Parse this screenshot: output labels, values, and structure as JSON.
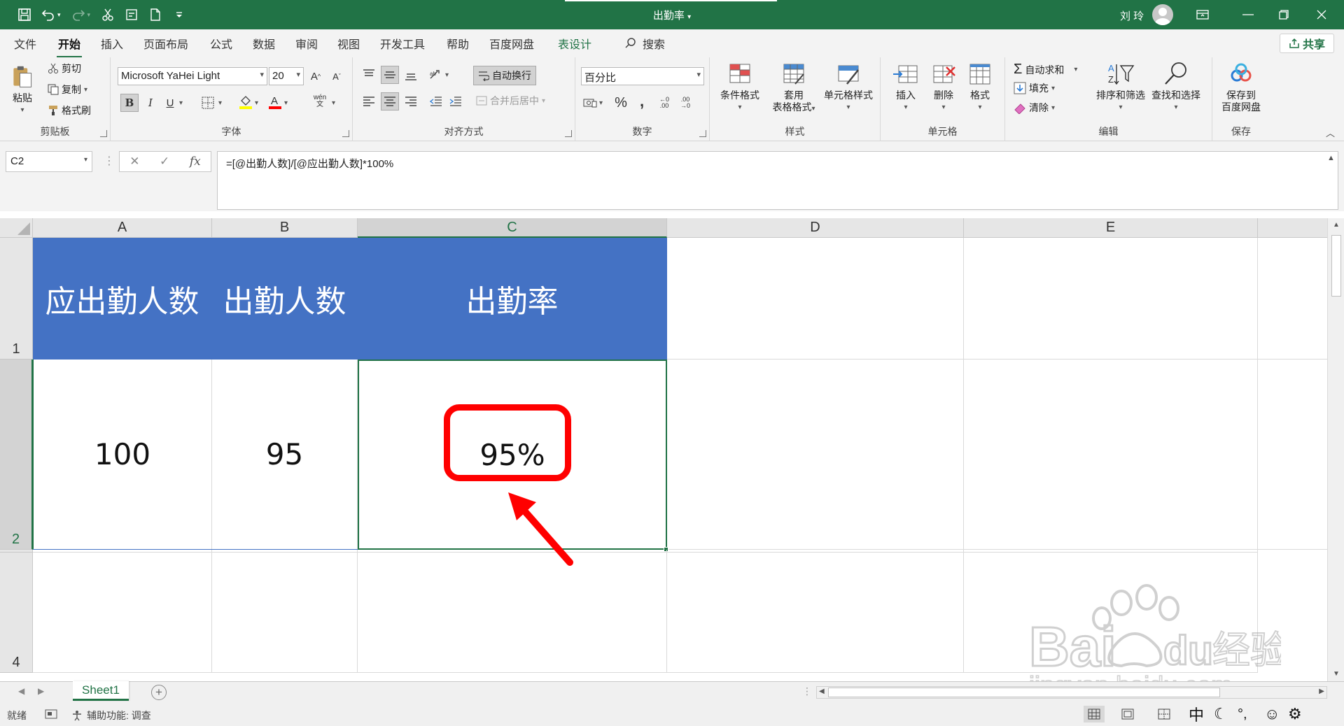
{
  "window": {
    "title": "出勤率",
    "user": "刘 玲"
  },
  "tabs": [
    "文件",
    "开始",
    "插入",
    "页面布局",
    "公式",
    "数据",
    "审阅",
    "视图",
    "开发工具",
    "帮助",
    "百度网盘",
    "表设计"
  ],
  "search_label": "搜索",
  "share_label": "共享",
  "ribbon": {
    "clipboard": {
      "paste": "粘贴",
      "cut": "剪切",
      "copy": "复制",
      "format_painter": "格式刷",
      "label": "剪贴板"
    },
    "font": {
      "name": "Microsoft YaHei Light",
      "size": "20",
      "label": "字体",
      "phonetic": "wén",
      "phonetic_sub": "文"
    },
    "alignment": {
      "wrap": "自动换行",
      "merge": "合并后居中",
      "label": "对齐方式"
    },
    "number": {
      "format": "百分比",
      "label": "数字"
    },
    "styles": {
      "conditional": "条件格式",
      "table_format_1": "套用",
      "table_format_2": "表格格式",
      "cell_styles": "单元格样式",
      "label": "样式"
    },
    "cells": {
      "insert": "插入",
      "delete": "删除",
      "format": "格式",
      "label": "单元格"
    },
    "editing": {
      "autosum": "自动求和",
      "fill": "填充",
      "clear": "清除",
      "sort_filter": "排序和筛选",
      "find_select": "查找和选择",
      "label": "编辑"
    },
    "save": {
      "save_1": "保存到",
      "save_2": "百度网盘",
      "label": "保存"
    }
  },
  "formula_bar": {
    "name_box": "C2",
    "formula": "=[@出勤人数]/[@应出勤人数]*100%"
  },
  "columns": [
    "A",
    "B",
    "C",
    "D",
    "E"
  ],
  "rows": [
    "1",
    "2",
    "4"
  ],
  "table": {
    "headers": [
      "应出勤人数",
      "出勤人数",
      "出勤率"
    ],
    "row": [
      "100",
      "95",
      "95%"
    ]
  },
  "sheet_tab": "Sheet1",
  "status": {
    "ready": "就绪",
    "accessibility": "辅助功能: 调查",
    "ime_lang": "中",
    "ime_punct": "°,"
  },
  "watermark": {
    "brand": "Bai",
    "brand2": "du",
    "brand3": "经验",
    "url": "jingyan.baidu.com"
  },
  "colors": {
    "excel_green": "#217346",
    "header_fill": "#4472c4",
    "annotation_red": "#ff0000"
  }
}
